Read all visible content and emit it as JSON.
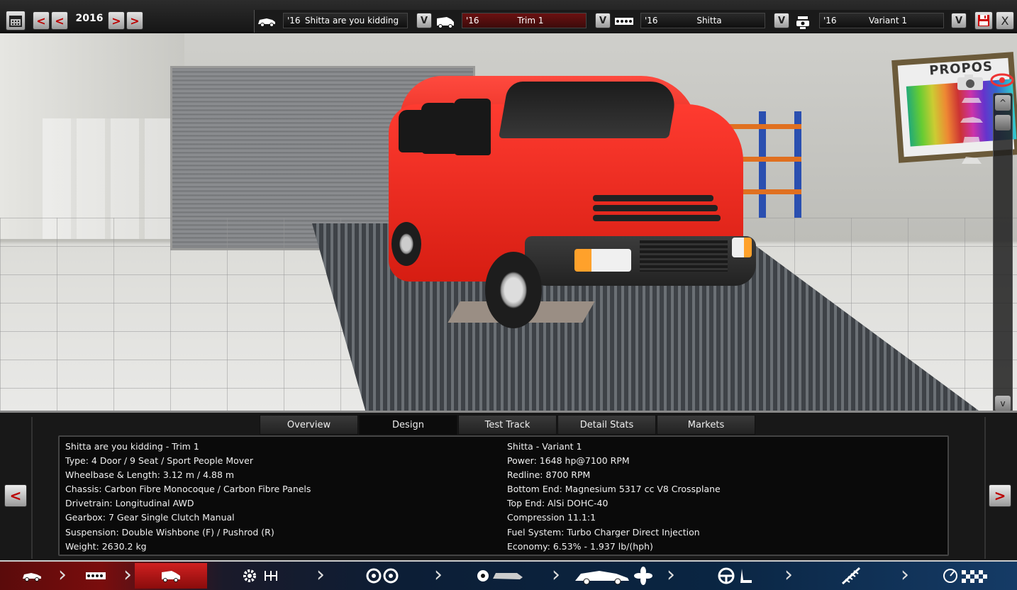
{
  "topbar": {
    "year": "2016",
    "prev_label": "<",
    "next_label": ">",
    "selectors": [
      {
        "year": "'16",
        "name": "Shitta are you kidding",
        "icon": "car-model-icon"
      },
      {
        "year": "'16",
        "name": "Trim 1",
        "icon": "trim-icon"
      },
      {
        "year": "'16",
        "name": "Shitta",
        "icon": "engine-family-icon"
      },
      {
        "year": "'16",
        "name": "Variant 1",
        "icon": "engine-variant-icon"
      }
    ],
    "dropdown_label": "V",
    "close_label": "X"
  },
  "viewport": {
    "board_text": "PROPOS",
    "scroll_up": "^",
    "scroll_down": "v"
  },
  "tabs": [
    "Overview",
    "Design",
    "Test Track",
    "Detail Stats",
    "Markets"
  ],
  "active_tab": "Design",
  "info": {
    "left": [
      "Shitta are you kidding - Trim 1",
      "Type: 4 Door / 9 Seat / Sport People Mover",
      "Wheelbase & Length: 3.12 m / 4.88 m",
      "Chassis: Carbon Fibre Monocoque / Carbon Fibre Panels",
      "Drivetrain: Longitudinal AWD",
      "Gearbox: 7 Gear Single Clutch Manual",
      "Suspension: Double Wishbone (F) / Pushrod (R)",
      "Weight: 2630.2 kg"
    ],
    "right": [
      "Shitta - Variant 1",
      "Power: 1648 hp@7100 RPM",
      "Redline: 8700 RPM",
      "Bottom End: Magnesium 5317 cc V8 Crossplane",
      "Top End: AlSi DOHC-40",
      "Compression 11.1:1",
      "Fuel System: Turbo Charger Direct Injection",
      "Economy: 6.53% - 1.937 lb/(hph)"
    ]
  },
  "nav": {
    "prev_label": "<",
    "next_label": ">",
    "items": [
      "car-model-icon",
      "chassis-icon",
      "trim-icon",
      "engine-gearbox-icon",
      "wheels-brakes-icon",
      "aero-cooling-icon",
      "interior-icon",
      "suspension-icon",
      "testing-icon"
    ]
  },
  "colors": {
    "accent_red": "#d02020",
    "nav_blue": "#0a2542"
  }
}
